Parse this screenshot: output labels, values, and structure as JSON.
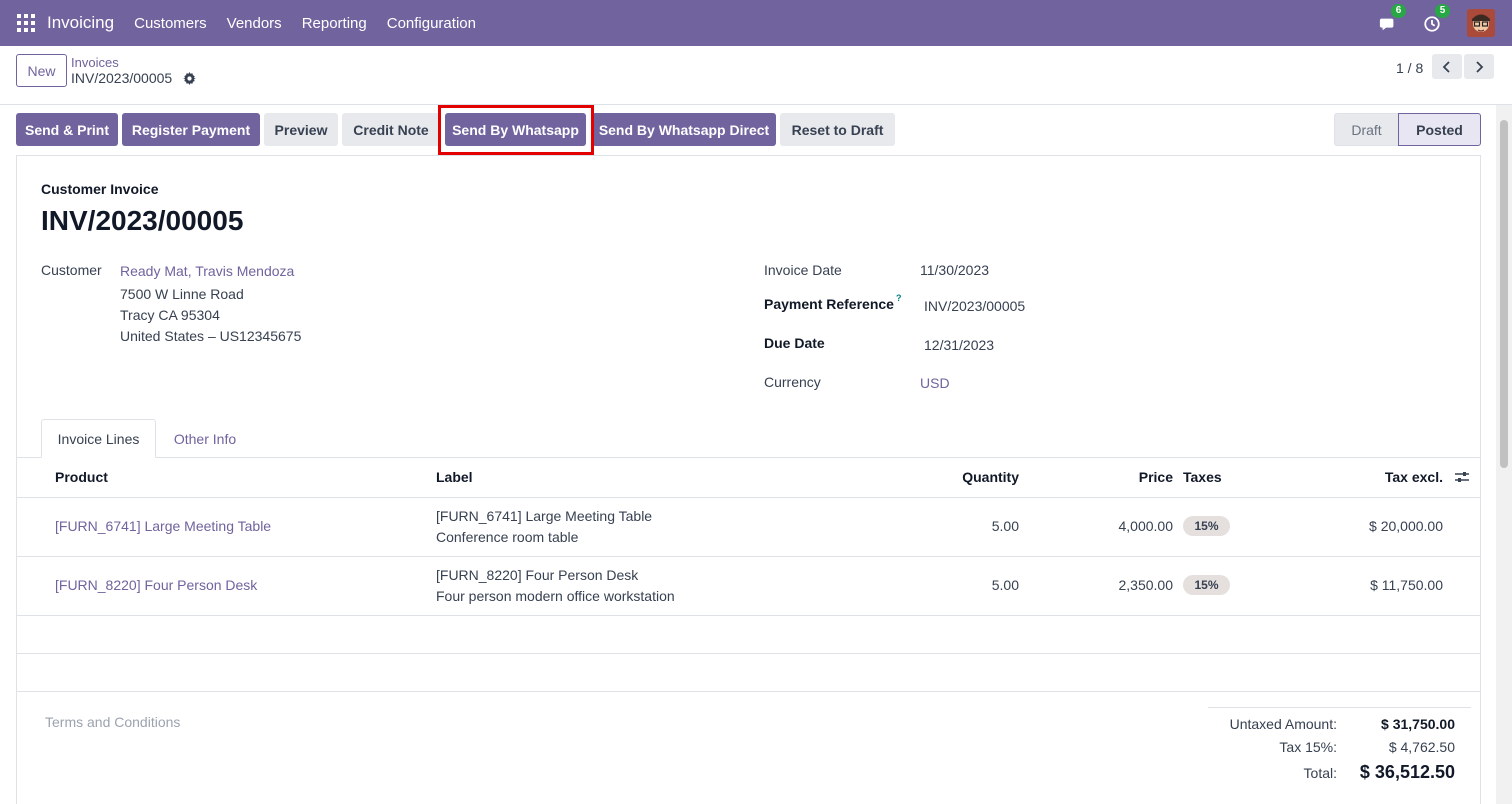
{
  "navbar": {
    "app_name": "Invoicing",
    "menus": [
      "Customers",
      "Vendors",
      "Reporting",
      "Configuration"
    ],
    "messages_count": "6",
    "activities_count": "5",
    "color": "#71639e"
  },
  "control": {
    "new_label": "New",
    "breadcrumb_parent": "Invoices",
    "breadcrumb_current": "INV/2023/00005",
    "pager": "1 / 8"
  },
  "actions": {
    "send_print": "Send & Print",
    "register_payment": "Register Payment",
    "preview": "Preview",
    "credit_note": "Credit Note",
    "send_whatsapp": "Send By Whatsapp",
    "send_whatsapp_direct": "Send By Whatsapp Direct",
    "reset_draft": "Reset to Draft"
  },
  "status": {
    "draft": "Draft",
    "posted": "Posted",
    "current": "Posted"
  },
  "invoice": {
    "type_label": "Customer Invoice",
    "name": "INV/2023/00005",
    "customer_label": "Customer",
    "customer_name": "Ready Mat, Travis Mendoza",
    "address_line1": "7500 W Linne Road",
    "address_line2": "Tracy CA 95304",
    "address_line3": "United States – US12345675",
    "invoice_date_label": "Invoice Date",
    "invoice_date": "11/30/2023",
    "payment_ref_label": "Payment Reference",
    "payment_ref_help": "?",
    "payment_ref": "INV/2023/00005",
    "due_date_label": "Due Date",
    "due_date": "12/31/2023",
    "currency_label": "Currency",
    "currency": "USD"
  },
  "tabs": {
    "invoice_lines": "Invoice Lines",
    "other_info": "Other Info"
  },
  "table": {
    "headers": {
      "product": "Product",
      "label": "Label",
      "quantity": "Quantity",
      "price": "Price",
      "taxes": "Taxes",
      "tax_excl": "Tax excl."
    },
    "rows": [
      {
        "product": "[FURN_6741] Large Meeting Table",
        "label_line1": "[FURN_6741] Large Meeting Table",
        "label_line2": "Conference room table",
        "quantity": "5.00",
        "price": "4,000.00",
        "tax": "15%",
        "subtotal": "$ 20,000.00"
      },
      {
        "product": "[FURN_8220] Four Person Desk",
        "label_line1": "[FURN_8220] Four Person Desk",
        "label_line2": "Four person modern office workstation",
        "quantity": "5.00",
        "price": "2,350.00",
        "tax": "15%",
        "subtotal": "$ 11,750.00"
      }
    ]
  },
  "footer": {
    "terms_placeholder": "Terms and Conditions",
    "untaxed_label": "Untaxed Amount:",
    "untaxed_value": "$ 31,750.00",
    "tax_label": "Tax 15%:",
    "tax_value": "$ 4,762.50",
    "total_label": "Total:",
    "total_value": "$ 36,512.50"
  }
}
